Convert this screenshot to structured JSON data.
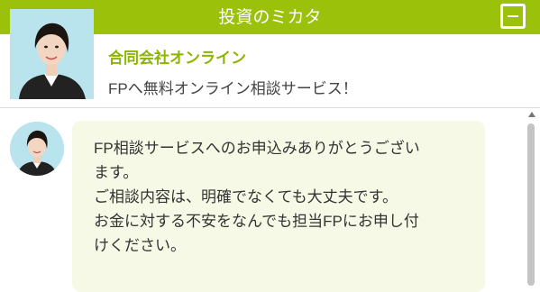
{
  "header": {
    "title": "投資のミカタ",
    "minimize_icon": "minimize-icon"
  },
  "profile": {
    "company": "合同会社オンライン",
    "tagline": "FPへ無料オンライン相談サービス！"
  },
  "chat": {
    "messages": [
      {
        "sender": "agent",
        "text": "FP相談サービスへのお申込みありがとうござい\nます。\nご相談内容は、明確でなくても大丈夫です。\nお金に対する不安をなんでも担当FPにお申し付\nけください。"
      }
    ]
  },
  "colors": {
    "accent": "#9cc10b",
    "company_text": "#8cb500",
    "bubble": "#f6f9e6"
  }
}
